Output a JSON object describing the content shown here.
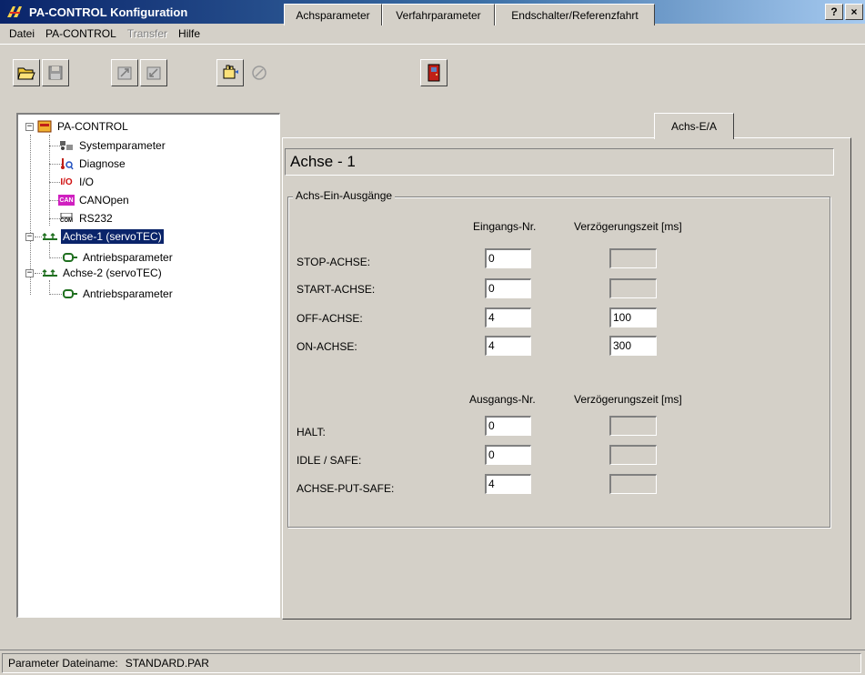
{
  "window": {
    "title": "PA-CONTROL Konfiguration",
    "help_btn": "?",
    "close_btn": "×"
  },
  "menu": [
    {
      "label": "Datei",
      "disabled": false
    },
    {
      "label": "PA-CONTROL",
      "disabled": false
    },
    {
      "label": "Transfer",
      "disabled": true
    },
    {
      "label": "Hilfe",
      "disabled": false
    }
  ],
  "toolbar": {
    "icons": [
      "open-folder-icon",
      "save-disk-icon",
      "upload-icon",
      "download-icon",
      "settings-hand-icon",
      "disabled-circle-icon",
      "exit-door-icon"
    ]
  },
  "tree": {
    "root": "PA-CONTROL",
    "items": [
      {
        "label": "Systemparameter",
        "icon": "system-icon"
      },
      {
        "label": "Diagnose",
        "icon": "diagnose-icon"
      },
      {
        "label": "I/O",
        "icon": "io-icon"
      },
      {
        "label": "CANOpen",
        "icon": "can-icon"
      },
      {
        "label": "RS232",
        "icon": "com-icon"
      },
      {
        "label": "Achse-1 (servoTEC)",
        "icon": "axis-icon"
      },
      {
        "label": "Antriebsparameter",
        "icon": "drive-icon"
      },
      {
        "label": "Achse-2 (servoTEC)",
        "icon": "axis-icon"
      },
      {
        "label": "Antriebsparameter",
        "icon": "drive-icon"
      }
    ],
    "io_glyph": "I/O",
    "can_glyph": "CAN",
    "com_glyph": "COM"
  },
  "tabs": [
    "Achsparameter",
    "Verfahrparameter",
    "Endschalter/Referenzfahrt",
    "Achs-E/A"
  ],
  "axis_title": "Achse - 1",
  "group": {
    "legend": "Achs-Ein-Ausgänge",
    "inputs_header": "Eingangs-Nr.",
    "delay_header": "Verzögerungszeit [ms]",
    "inputs": [
      {
        "label": "STOP-ACHSE:",
        "value": "0",
        "delay": ""
      },
      {
        "label": "START-ACHSE:",
        "value": "0",
        "delay": ""
      },
      {
        "label": "OFF-ACHSE:",
        "value": "4",
        "delay": "100"
      },
      {
        "label": "ON-ACHSE:",
        "value": "4",
        "delay": "300"
      }
    ],
    "outputs_header": "Ausgangs-Nr.",
    "delay_header2": "Verzögerungszeit [ms]",
    "outputs": [
      {
        "label": "HALT:",
        "value": "0",
        "delay": ""
      },
      {
        "label": "IDLE / SAFE:",
        "value": "0",
        "delay": ""
      },
      {
        "label": "ACHSE-PUT-SAFE:",
        "value": "4",
        "delay": ""
      }
    ]
  },
  "status": {
    "label": "Parameter Dateiname:",
    "value": "STANDARD.PAR"
  }
}
